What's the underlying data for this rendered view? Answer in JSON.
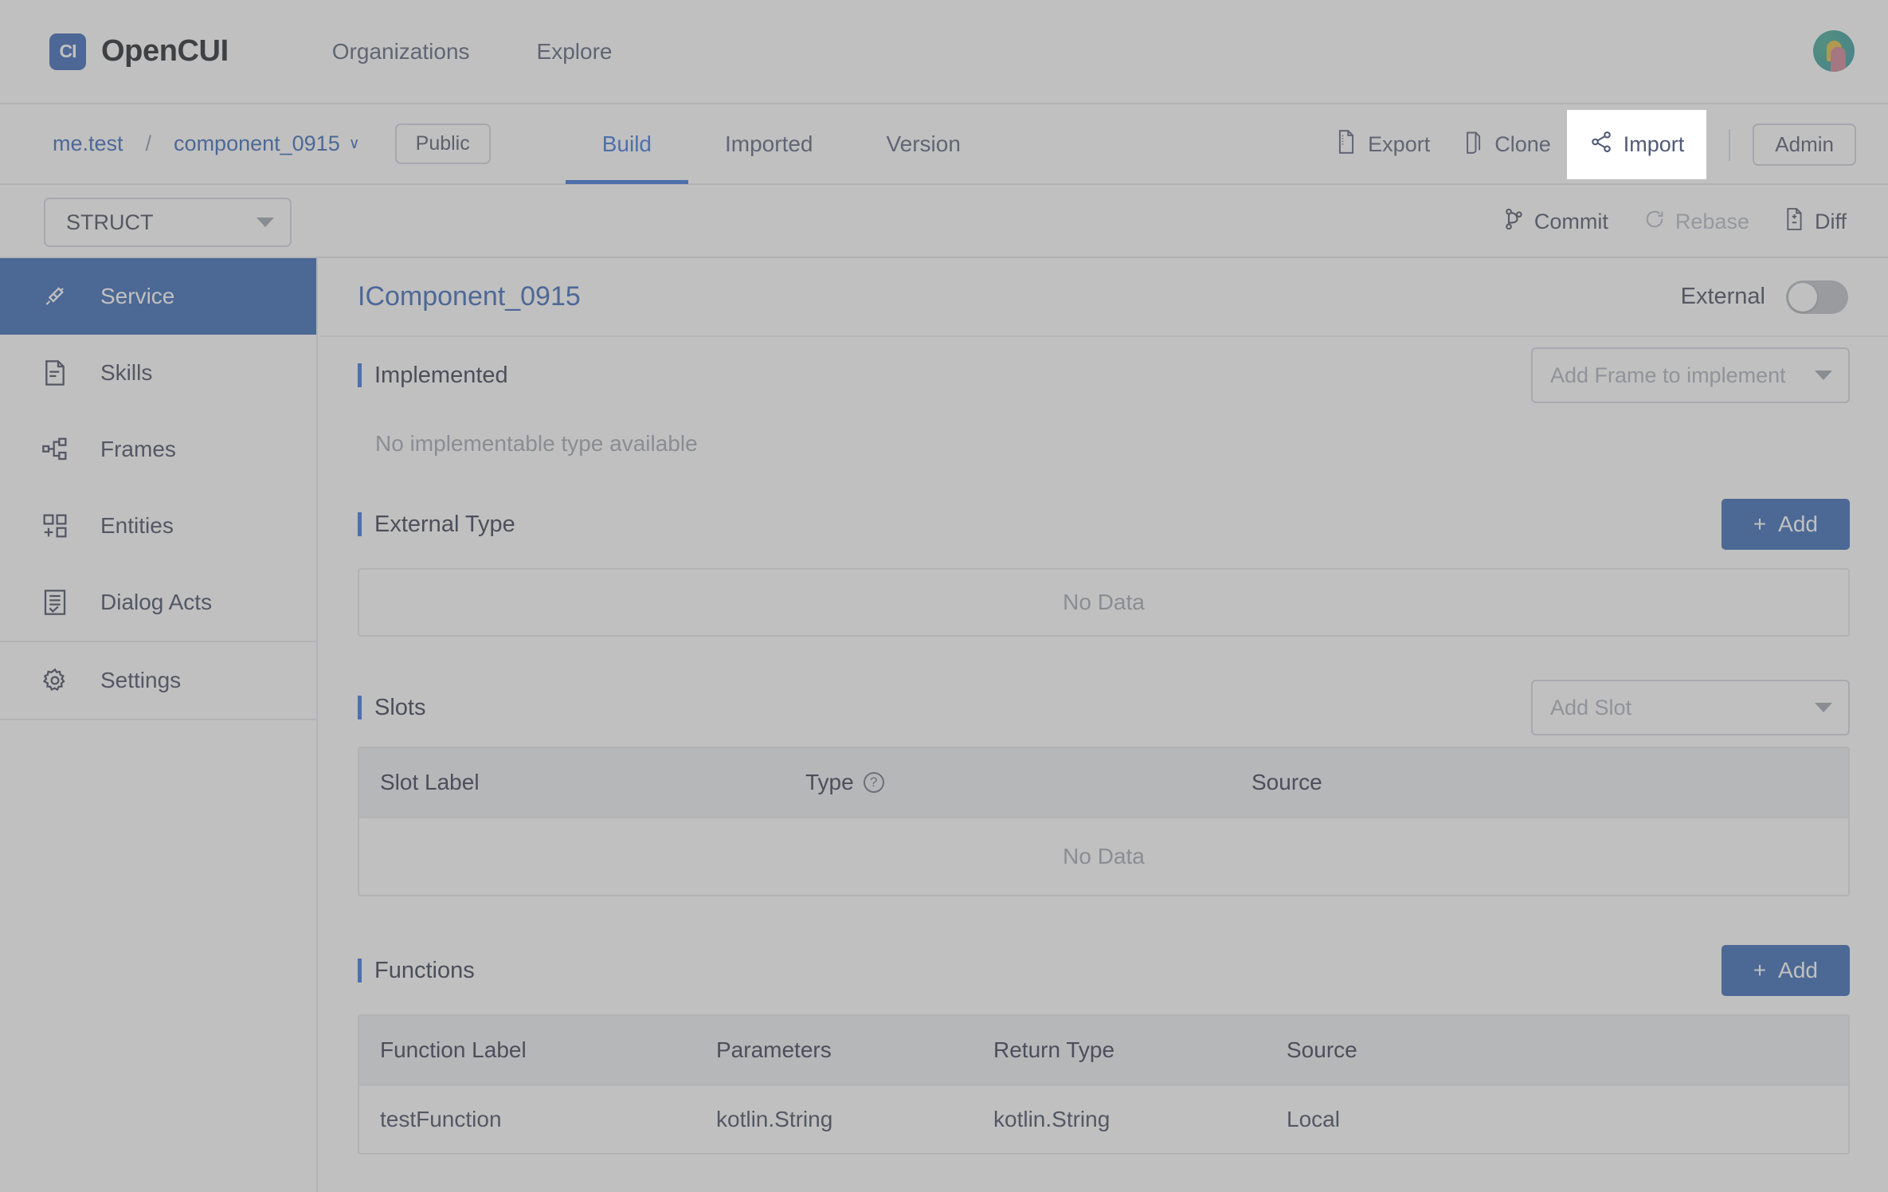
{
  "topnav": {
    "brand_mark": "CI",
    "brand_name": "OpenCUI",
    "links": [
      {
        "label": "Organizations"
      },
      {
        "label": "Explore"
      }
    ],
    "avatar_name": "user-avatar"
  },
  "subbar": {
    "breadcrumb": {
      "org": "me.test",
      "separator": "/",
      "project": "component_0915",
      "chevron": "∨"
    },
    "visibility_pill": "Public",
    "tabs": [
      {
        "label": "Build",
        "active": true
      },
      {
        "label": "Imported",
        "active": false
      },
      {
        "label": "Version",
        "active": false
      }
    ],
    "actions": [
      {
        "label": "Export",
        "icon": "file-export-icon"
      },
      {
        "label": "Clone",
        "icon": "copy-icon"
      },
      {
        "label": "Import",
        "icon": "share-nodes-icon",
        "highlighted": true
      }
    ],
    "admin_label": "Admin"
  },
  "structbar": {
    "struct_select_value": "STRUCT",
    "actions": [
      {
        "label": "Commit",
        "icon": "branch-icon",
        "disabled": false
      },
      {
        "label": "Rebase",
        "icon": "refresh-icon",
        "disabled": true
      },
      {
        "label": "Diff",
        "icon": "diff-file-icon",
        "disabled": false
      }
    ]
  },
  "sidebar": {
    "items": [
      {
        "label": "Service",
        "icon": "plug-icon",
        "active": true
      },
      {
        "label": "Skills",
        "icon": "document-icon",
        "active": false
      },
      {
        "label": "Frames",
        "icon": "sitemap-icon",
        "active": false
      },
      {
        "label": "Entities",
        "icon": "blocks-icon",
        "active": false
      },
      {
        "label": "Dialog Acts",
        "icon": "list-doc-icon",
        "active": false
      },
      {
        "label": "Settings",
        "icon": "gear-icon",
        "active": false
      }
    ]
  },
  "content": {
    "title": "IComponent_0915",
    "external_label": "External",
    "external_on": false,
    "implemented": {
      "title": "Implemented",
      "dropdown_placeholder": "Add Frame to implement",
      "empty_text": "No implementable type available"
    },
    "external_type": {
      "title": "External Type",
      "add_label": "Add",
      "empty_text": "No Data"
    },
    "slots": {
      "title": "Slots",
      "dropdown_placeholder": "Add Slot",
      "columns": [
        "Slot Label",
        "Type",
        "Source"
      ],
      "type_help_icon": "?",
      "empty_text": "No Data",
      "rows": []
    },
    "functions": {
      "title": "Functions",
      "add_label": "Add",
      "columns": [
        "Function Label",
        "Parameters",
        "Return Type",
        "Source"
      ],
      "rows": [
        {
          "function_label": "testFunction",
          "parameters": "kotlin.String",
          "return_type": "kotlin.String",
          "source": "Local"
        }
      ]
    }
  },
  "colors": {
    "brand_blue": "#2d5fb0",
    "accent_blue": "#2f6ddb",
    "link_blue": "#2f5fb3",
    "muted": "#9fa3ad"
  }
}
